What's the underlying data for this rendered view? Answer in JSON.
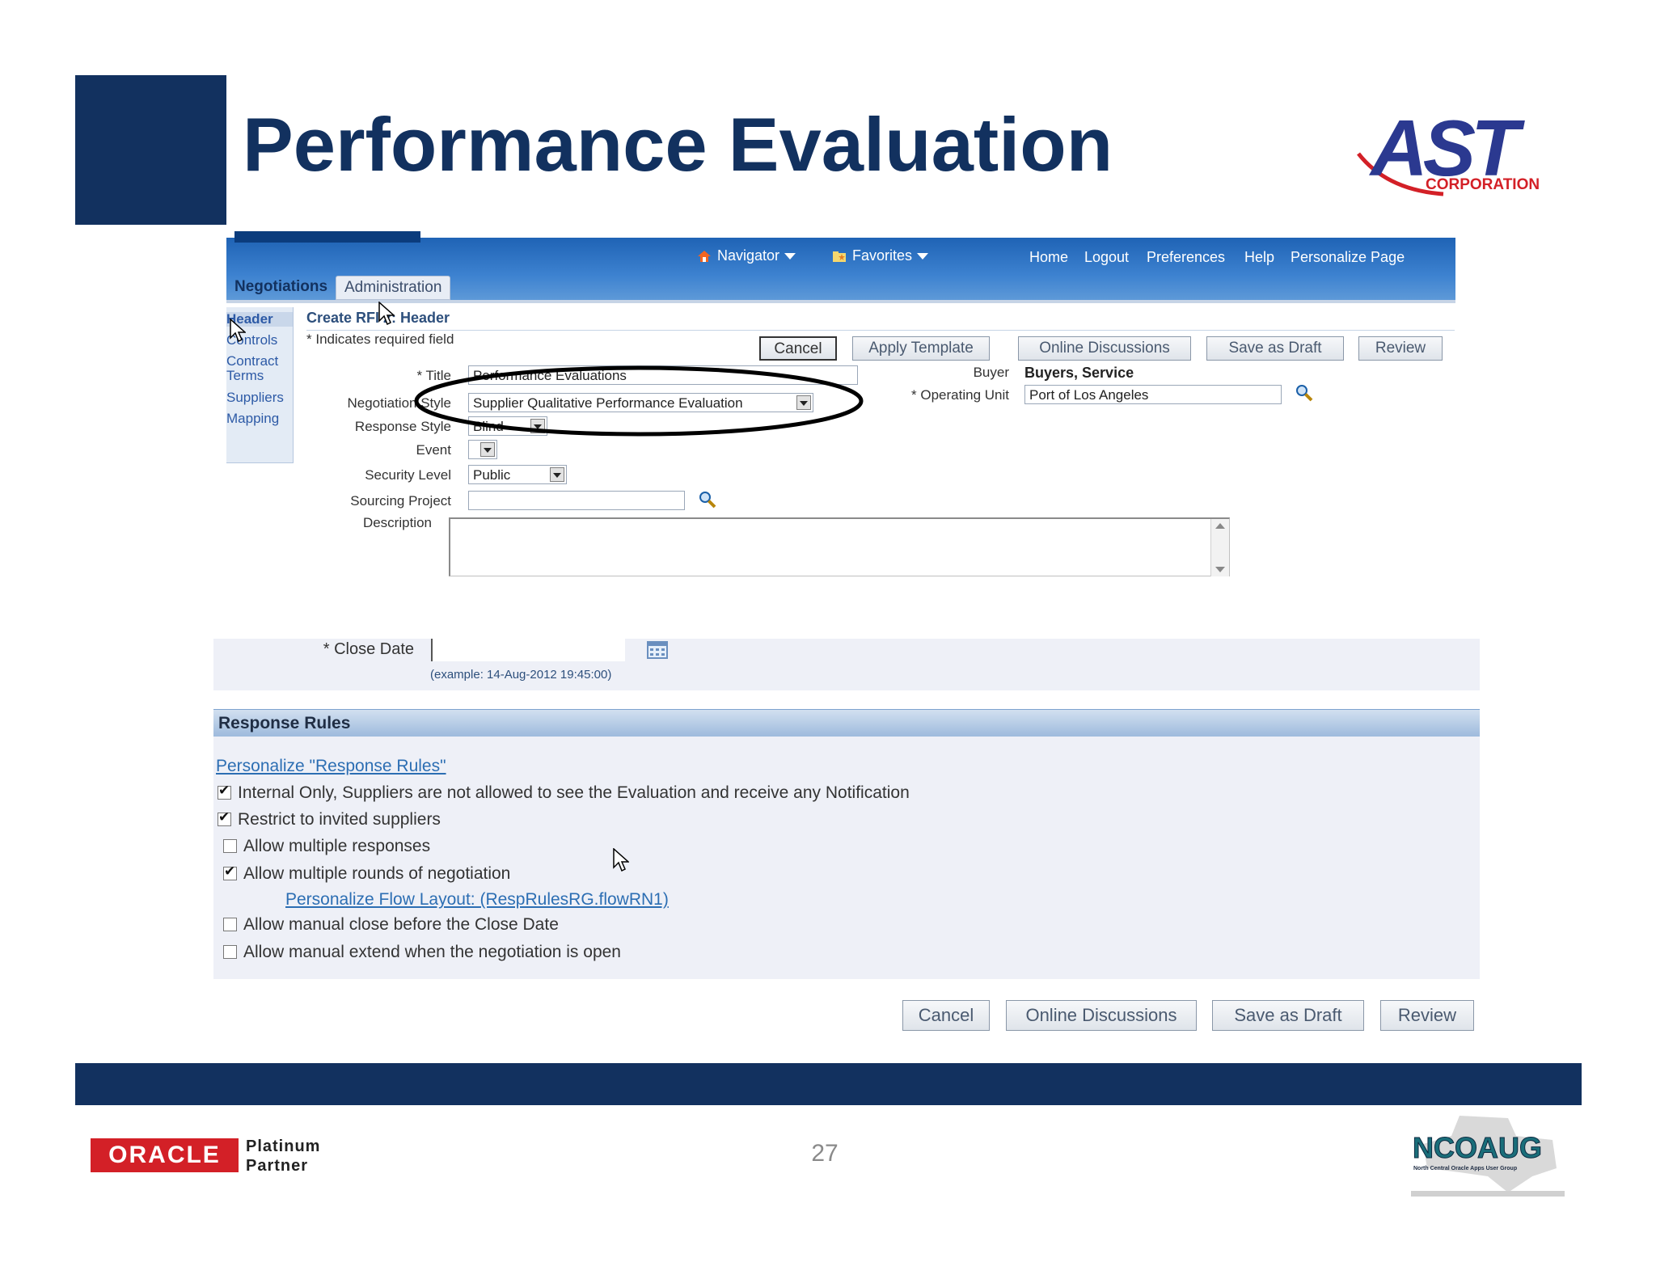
{
  "slide": {
    "title": "Performance Evaluation",
    "page_number": "27",
    "logos": {
      "ast": {
        "main": "AST",
        "sub": "CORPORATION"
      },
      "oracle": {
        "name": "ORACLE",
        "tag": "Platinum",
        "tag2": "Partner"
      },
      "ncoaug": {
        "name": "NCOAUG",
        "sub": "North Central Oracle Apps User Group"
      }
    },
    "colors": {
      "navy": "#12315f",
      "oracle_red": "#d32027",
      "ast_red": "#d32027",
      "link_blue": "#2c6eb3"
    }
  },
  "app": {
    "topnav": {
      "navigator": "Navigator",
      "favorites": "Favorites",
      "links": [
        "Home",
        "Logout",
        "Preferences",
        "Help",
        "Personalize Page"
      ]
    },
    "tabs": {
      "negotiations": "Negotiations",
      "administration": "Administration"
    },
    "leftnav": [
      "Header",
      "Controls",
      "Contract",
      "Terms",
      "Suppliers",
      "Mapping"
    ],
    "page": {
      "title": "Create RFI 2: Header",
      "required_note": "Indicates required field"
    },
    "buttons": {
      "cancel": "Cancel",
      "apply_template": "Apply Template",
      "online_discussions": "Online Discussions",
      "save_as_draft": "Save as Draft",
      "review": "Review"
    },
    "form": {
      "title_label": "Title",
      "title_value": "Performance Evaluations",
      "negotiation_style_label": "Negotiation Style",
      "negotiation_style_value": "Supplier Qualitative Performance Evaluation",
      "response_style_label": "Response Style",
      "response_style_value": "Blind",
      "event_label": "Event",
      "security_level_label": "Security Level",
      "security_level_value": "Public",
      "sourcing_project_label": "Sourcing Project",
      "description_label": "Description",
      "buyer_label": "Buyer",
      "buyer_value": "Buyers, Service",
      "operating_unit_label": "Operating Unit",
      "operating_unit_value": "Port of Los Angeles",
      "close_date_label": "Close Date",
      "close_date_example": "(example: 14-Aug-2012 19:45:00)",
      "required_marker": "*"
    },
    "response_rules": {
      "header": "Response Rules",
      "personalize_link": "Personalize \"Response Rules\"",
      "flow_link": "Personalize Flow Layout: (RespRulesRG.flowRN1)",
      "items": [
        {
          "label": "Internal Only, Suppliers are not allowed to see the Evaluation and receive any Notification",
          "checked": true
        },
        {
          "label": "Restrict to invited suppliers",
          "checked": true
        },
        {
          "label": "Allow multiple responses",
          "checked": false
        },
        {
          "label": "Allow multiple rounds of negotiation",
          "checked": true
        },
        {
          "label": "Allow manual close before the Close Date",
          "checked": false
        },
        {
          "label": "Allow manual extend when the negotiation is open",
          "checked": false
        }
      ]
    }
  }
}
